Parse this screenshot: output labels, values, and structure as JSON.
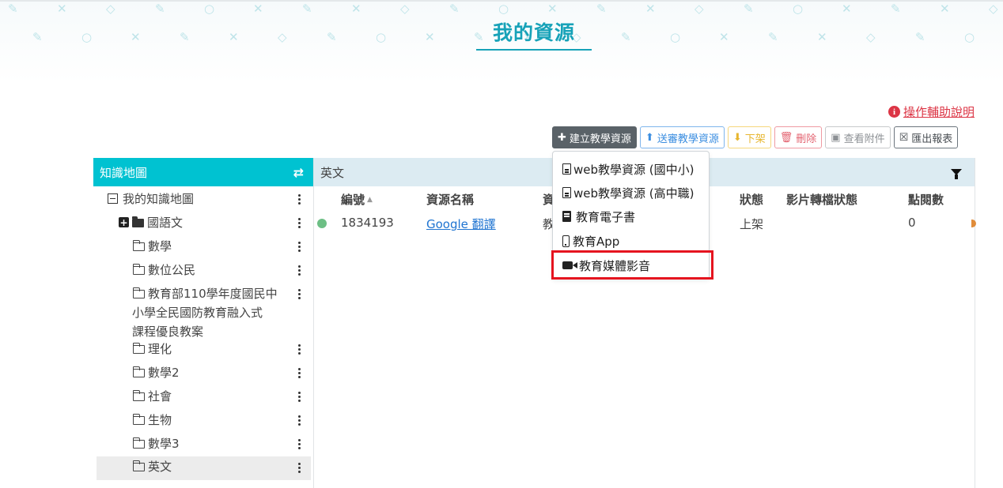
{
  "page": {
    "title": "我的資源"
  },
  "help": {
    "label": "操作輔助說明"
  },
  "toolbar": {
    "create_label": "建立教學資源",
    "send_review_label": "送審教學資源",
    "take_down_label": "下架",
    "delete_label": "刪除",
    "view_attachments_label": "查看附件",
    "export_label": "匯出報表"
  },
  "knowledge_map": {
    "header": "知識地圖",
    "root": "我的知識地圖",
    "items": [
      {
        "label": "國語文"
      },
      {
        "label": "數學"
      },
      {
        "label": "數位公民"
      },
      {
        "label": "教育部110學年度國民中小學全民國防教育融入式課程優良教案",
        "lines": [
          "教育部110學年度國民中",
          "小學全民國防教育融入式",
          "課程優良教案"
        ]
      },
      {
        "label": "理化"
      },
      {
        "label": "數學2"
      },
      {
        "label": "社會"
      },
      {
        "label": "生物"
      },
      {
        "label": "數學3"
      },
      {
        "label": "英文"
      }
    ]
  },
  "table": {
    "folder_title": "英文",
    "columns": {
      "id": "編號",
      "name": "資源名稱",
      "type": "資",
      "status": "狀態",
      "video_status": "影片轉檔狀態",
      "views": "點閱數"
    },
    "rows": [
      {
        "id": "1834193",
        "name": "Google 翻譯",
        "type": "教",
        "status": "上架",
        "video_status": "",
        "views": "0"
      }
    ]
  },
  "dropdown": {
    "items": [
      {
        "label": "web教學資源 (國中小)",
        "icon": "file-lines-icon"
      },
      {
        "label": "web教學資源 (高中職)",
        "icon": "file-lines-icon"
      },
      {
        "label": "教育電子書",
        "icon": "book-icon"
      },
      {
        "label": "教育App",
        "icon": "mobile-icon"
      },
      {
        "label": "教育媒體影音",
        "icon": "video-camera-icon"
      }
    ]
  },
  "colors": {
    "accent": "#17a2b8",
    "map_header": "#00c2d1",
    "table_header": "#dcebf2",
    "highlight": "#e5141f",
    "help": "#dc3545"
  }
}
